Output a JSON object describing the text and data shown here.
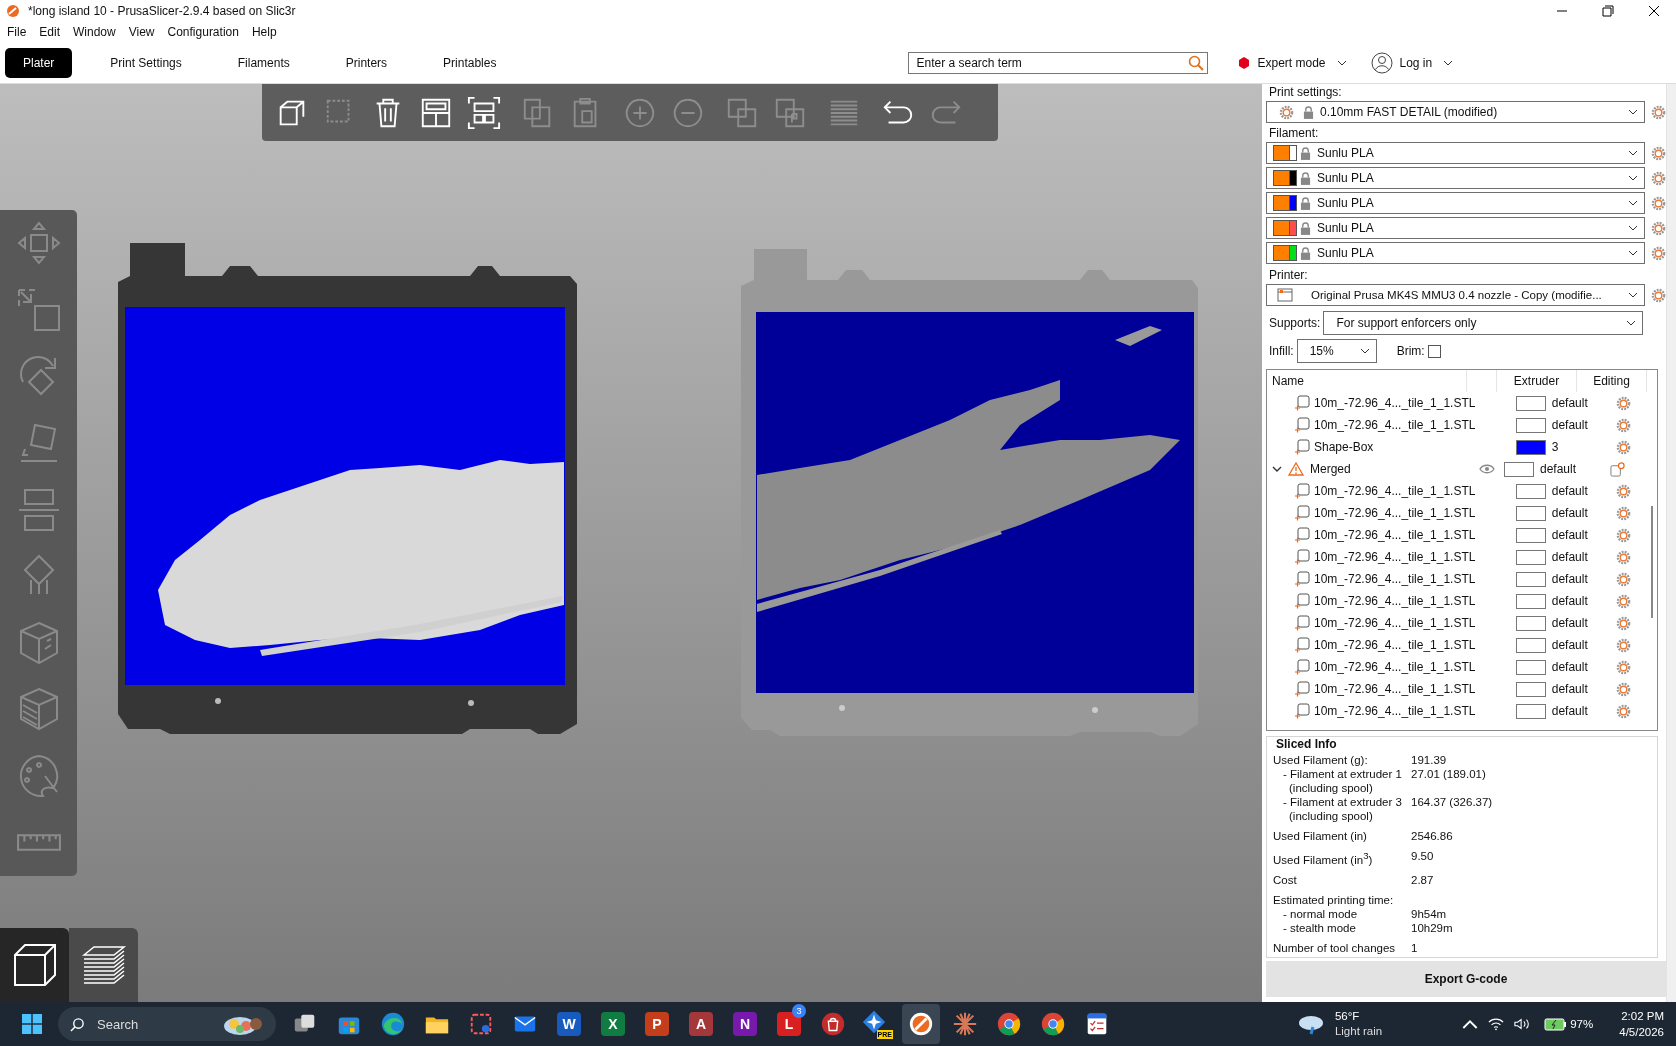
{
  "window": {
    "title": "*long island 10 - PrusaSlicer-2.9.4 based on Slic3r"
  },
  "menu": [
    "File",
    "Edit",
    "Window",
    "View",
    "Configuration",
    "Help"
  ],
  "tabs": [
    {
      "label": "Plater",
      "selected": true
    },
    {
      "label": "Print Settings",
      "selected": false
    },
    {
      "label": "Filaments",
      "selected": false
    },
    {
      "label": "Printers",
      "selected": false
    },
    {
      "label": "Printables",
      "selected": false
    }
  ],
  "search": {
    "placeholder": "Enter a search term"
  },
  "mode": {
    "label": "Expert mode",
    "color": "#e0001b"
  },
  "login": {
    "label": "Log in"
  },
  "toolbar": [
    {
      "kind": "add",
      "disabled": false
    },
    {
      "kind": "delete",
      "disabled": true
    },
    {
      "kind": "delete_all",
      "disabled": false
    },
    {
      "kind": "arrange",
      "disabled": false
    },
    {
      "kind": "arrange_selection",
      "disabled": false
    },
    {
      "kind": "copy",
      "disabled": true
    },
    {
      "kind": "paste",
      "disabled": true
    },
    {
      "kind": "add_instance",
      "disabled": true
    },
    {
      "kind": "remove_instance",
      "disabled": true
    },
    {
      "kind": "split_objects",
      "disabled": true
    },
    {
      "kind": "split_parts",
      "disabled": true
    },
    {
      "kind": "layers",
      "disabled": true
    },
    {
      "kind": "undo",
      "disabled": false
    },
    {
      "kind": "redo",
      "disabled": true
    }
  ],
  "view_buttons": [
    {
      "kind": "editor",
      "selected": true
    },
    {
      "kind": "preview",
      "selected": false
    }
  ],
  "print_settings": {
    "label": "Print settings:",
    "value": "0.10mm FAST DETAIL (modified)"
  },
  "filament": {
    "label": "Filament:",
    "items": [
      {
        "name": "Sunlu PLA",
        "filament": {
          "color": "#ff8000"
        },
        "extruder": {
          "color": "#ffffff"
        }
      },
      {
        "name": "Sunlu PLA",
        "filament": {
          "color": "#ff8000"
        },
        "extruder": {
          "color": "#000000"
        }
      },
      {
        "name": "Sunlu PLA",
        "filament": {
          "color": "#ff8000"
        },
        "extruder": {
          "color": "#0000ff"
        }
      },
      {
        "name": "Sunlu PLA",
        "filament": {
          "color": "#ff8000"
        },
        "extruder": {
          "color": "#ff4d4d"
        }
      },
      {
        "name": "Sunlu PLA",
        "filament": {
          "color": "#ff8000"
        },
        "extruder": {
          "color": "#00e01a"
        }
      }
    ]
  },
  "printer": {
    "label": "Printer:",
    "value": "Original Prusa MK4S MMU3 0.4 nozzle - Copy (modifie..."
  },
  "supports": {
    "label": "Supports:",
    "value": "For support enforcers only"
  },
  "infill": {
    "label": "Infill:",
    "value": "15%"
  },
  "brim": {
    "label": "Brim:",
    "checked": false
  },
  "object_list": {
    "columns": [
      "Name",
      "Extruder",
      "Editing"
    ],
    "rows": [
      {
        "kind": "part",
        "name": "10m_-72.96_4..._tile_1_1.STL",
        "extruder": "default",
        "color": "#ffffff"
      },
      {
        "kind": "part",
        "name": "10m_-72.96_4..._tile_1_1.STL",
        "extruder": "default",
        "color": "#ffffff"
      },
      {
        "kind": "part",
        "name": "Shape-Box",
        "extruder": "3",
        "color": "#0000ff"
      },
      {
        "kind": "object",
        "name": "Merged",
        "extruder": "default",
        "color": "#ffffff",
        "warning": true,
        "expanded": true,
        "children": [
          {
            "kind": "part",
            "name": "10m_-72.96_4..._tile_1_1.STL",
            "extruder": "default",
            "color": "#ffffff"
          },
          {
            "kind": "part",
            "name": "10m_-72.96_4..._tile_1_1.STL",
            "extruder": "default",
            "color": "#ffffff"
          },
          {
            "kind": "part",
            "name": "10m_-72.96_4..._tile_1_1.STL",
            "extruder": "default",
            "color": "#ffffff"
          },
          {
            "kind": "part",
            "name": "10m_-72.96_4..._tile_1_1.STL",
            "extruder": "default",
            "color": "#ffffff"
          },
          {
            "kind": "part",
            "name": "10m_-72.96_4..._tile_1_1.STL",
            "extruder": "default",
            "color": "#ffffff"
          },
          {
            "kind": "part",
            "name": "10m_-72.96_4..._tile_1_1.STL",
            "extruder": "default",
            "color": "#ffffff"
          },
          {
            "kind": "part",
            "name": "10m_-72.96_4..._tile_1_1.STL",
            "extruder": "default",
            "color": "#ffffff"
          },
          {
            "kind": "part",
            "name": "10m_-72.96_4..._tile_1_1.STL",
            "extruder": "default",
            "color": "#ffffff"
          },
          {
            "kind": "part",
            "name": "10m_-72.96_4..._tile_1_1.STL",
            "extruder": "default",
            "color": "#ffffff"
          },
          {
            "kind": "part",
            "name": "10m_-72.96_4..._tile_1_1.STL",
            "extruder": "default",
            "color": "#ffffff"
          },
          {
            "kind": "part",
            "name": "10m_-72.96_4..._tile_1_1.STL",
            "extruder": "default",
            "color": "#ffffff"
          }
        ]
      }
    ]
  },
  "sliced_info": {
    "title": "Sliced Info",
    "rows": [
      {
        "kind": "main",
        "label": "Used Filament (g):",
        "value": "191.39"
      },
      {
        "kind": "sub",
        "label": "- Filament at extruder 1",
        "note": "(including spool)",
        "value": "27.01 (189.01)"
      },
      {
        "kind": "sub",
        "label": "- Filament at extruder 3",
        "note": "(including spool)",
        "value": "164.37 (326.37)"
      },
      {
        "kind": "main",
        "label": "Used Filament (in)",
        "value": "2546.86"
      },
      {
        "kind": "main",
        "label": "Used Filament (in$^{3}$)",
        "value": "9.50"
      },
      {
        "kind": "main",
        "label": "Cost",
        "value": "2.87"
      },
      {
        "kind": "main",
        "label": "Estimated printing time:"
      },
      {
        "kind": "sub",
        "label": "- normal mode",
        "value": "9h54m"
      },
      {
        "kind": "sub",
        "label": "- stealth mode",
        "value": "10h29m"
      },
      {
        "kind": "main",
        "label": "Number of tool changes",
        "value": "1"
      }
    ]
  },
  "export_button": "Export G-code",
  "taskbar": {
    "search": "Search",
    "apps": [
      {
        "kind": "tiles",
        "selected": false
      },
      {
        "kind": "store",
        "selected": false
      },
      {
        "kind": "wave",
        "selected": false
      },
      {
        "kind": "folder",
        "selected": false
      },
      {
        "kind": "snip",
        "selected": false
      },
      {
        "kind": "mail",
        "selected": false
      },
      {
        "kind": "letter",
        "letter": "W",
        "color": "#185abd",
        "selected": false
      },
      {
        "kind": "letter",
        "letter": "X",
        "color": "#107c41",
        "selected": false
      },
      {
        "kind": "letter",
        "letter": "P",
        "color": "#c43e1c",
        "selected": false
      },
      {
        "kind": "letter",
        "letter": "A",
        "color": "#a4373a",
        "selected": false
      },
      {
        "kind": "letter",
        "letter": "N",
        "color": "#7719aa",
        "selected": false
      },
      {
        "kind": "letter",
        "letter": "L",
        "color": "#d92020",
        "badge": "3",
        "selected": false
      },
      {
        "kind": "bag",
        "selected": false
      },
      {
        "kind": "pre",
        "label": "PRE",
        "selected": false
      },
      {
        "kind": "slicer",
        "selected": true
      },
      {
        "kind": "spark",
        "selected": false
      },
      {
        "kind": "browser",
        "selected": false
      },
      {
        "kind": "browser",
        "selected": false
      },
      {
        "kind": "checklist",
        "selected": false
      }
    ],
    "weather": {
      "temp": "56°F",
      "text": "Light rain"
    },
    "battery": "97%",
    "time": "2:02 PM",
    "date": "4/5/2026"
  }
}
